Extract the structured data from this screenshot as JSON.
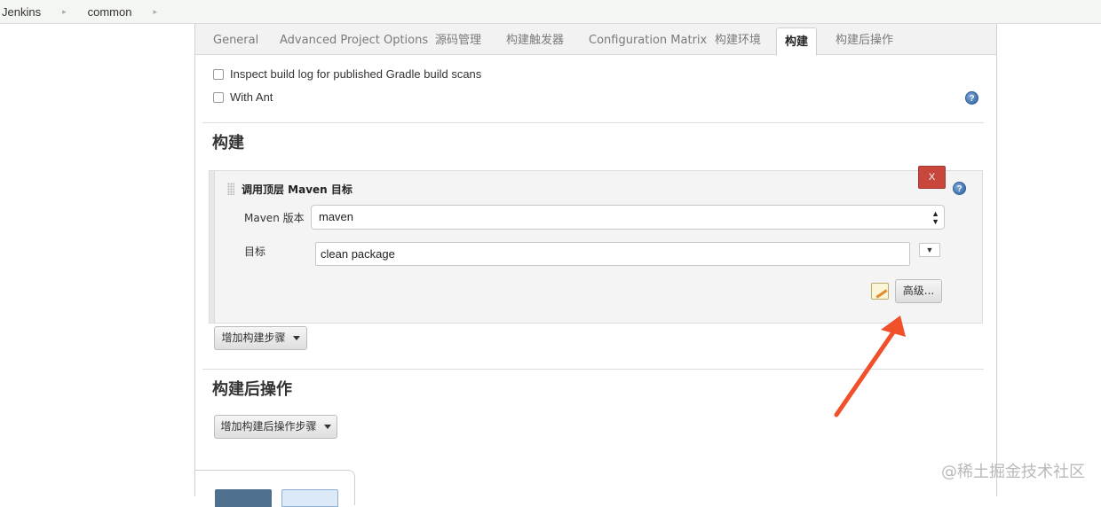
{
  "breadcrumb": {
    "items": [
      "Jenkins",
      "common"
    ],
    "separator": "▸"
  },
  "tabs": [
    {
      "label": "General",
      "active": false
    },
    {
      "label": "Advanced Project Options",
      "active": false
    },
    {
      "label": "源码管理",
      "active": false
    },
    {
      "label": "构建触发器",
      "active": false
    },
    {
      "label": "Configuration Matrix",
      "active": false
    },
    {
      "label": "构建环境",
      "active": false
    },
    {
      "label": "构建",
      "active": true
    },
    {
      "label": "构建后操作",
      "active": false
    }
  ],
  "build_env_options": [
    {
      "label": "Inspect build log for published Gradle build scans",
      "checked": false
    },
    {
      "label": "With Ant",
      "checked": false
    }
  ],
  "build_section": {
    "title": "构建",
    "step": {
      "title": "调用顶层 Maven 目标",
      "delete_label": "X",
      "maven_version_label": "Maven 版本",
      "maven_version_value": "maven",
      "goals_label": "目标",
      "goals_value": "clean package",
      "expand_icon": "▼",
      "advanced_label": "高级..."
    },
    "add_step_label": "增加构建步骤"
  },
  "post_build_section": {
    "title": "构建后操作",
    "add_step_label": "增加构建后操作步骤"
  },
  "help_glyph": "?",
  "select_arrows": "▲▼",
  "annotation": {
    "arrow_color": "#f0502a"
  },
  "colors": {
    "delete_button": "#c9463d",
    "help_icon": "#2f5f9a",
    "save_button": "#4f6f8f"
  },
  "watermark": "@稀土掘金技术社区"
}
